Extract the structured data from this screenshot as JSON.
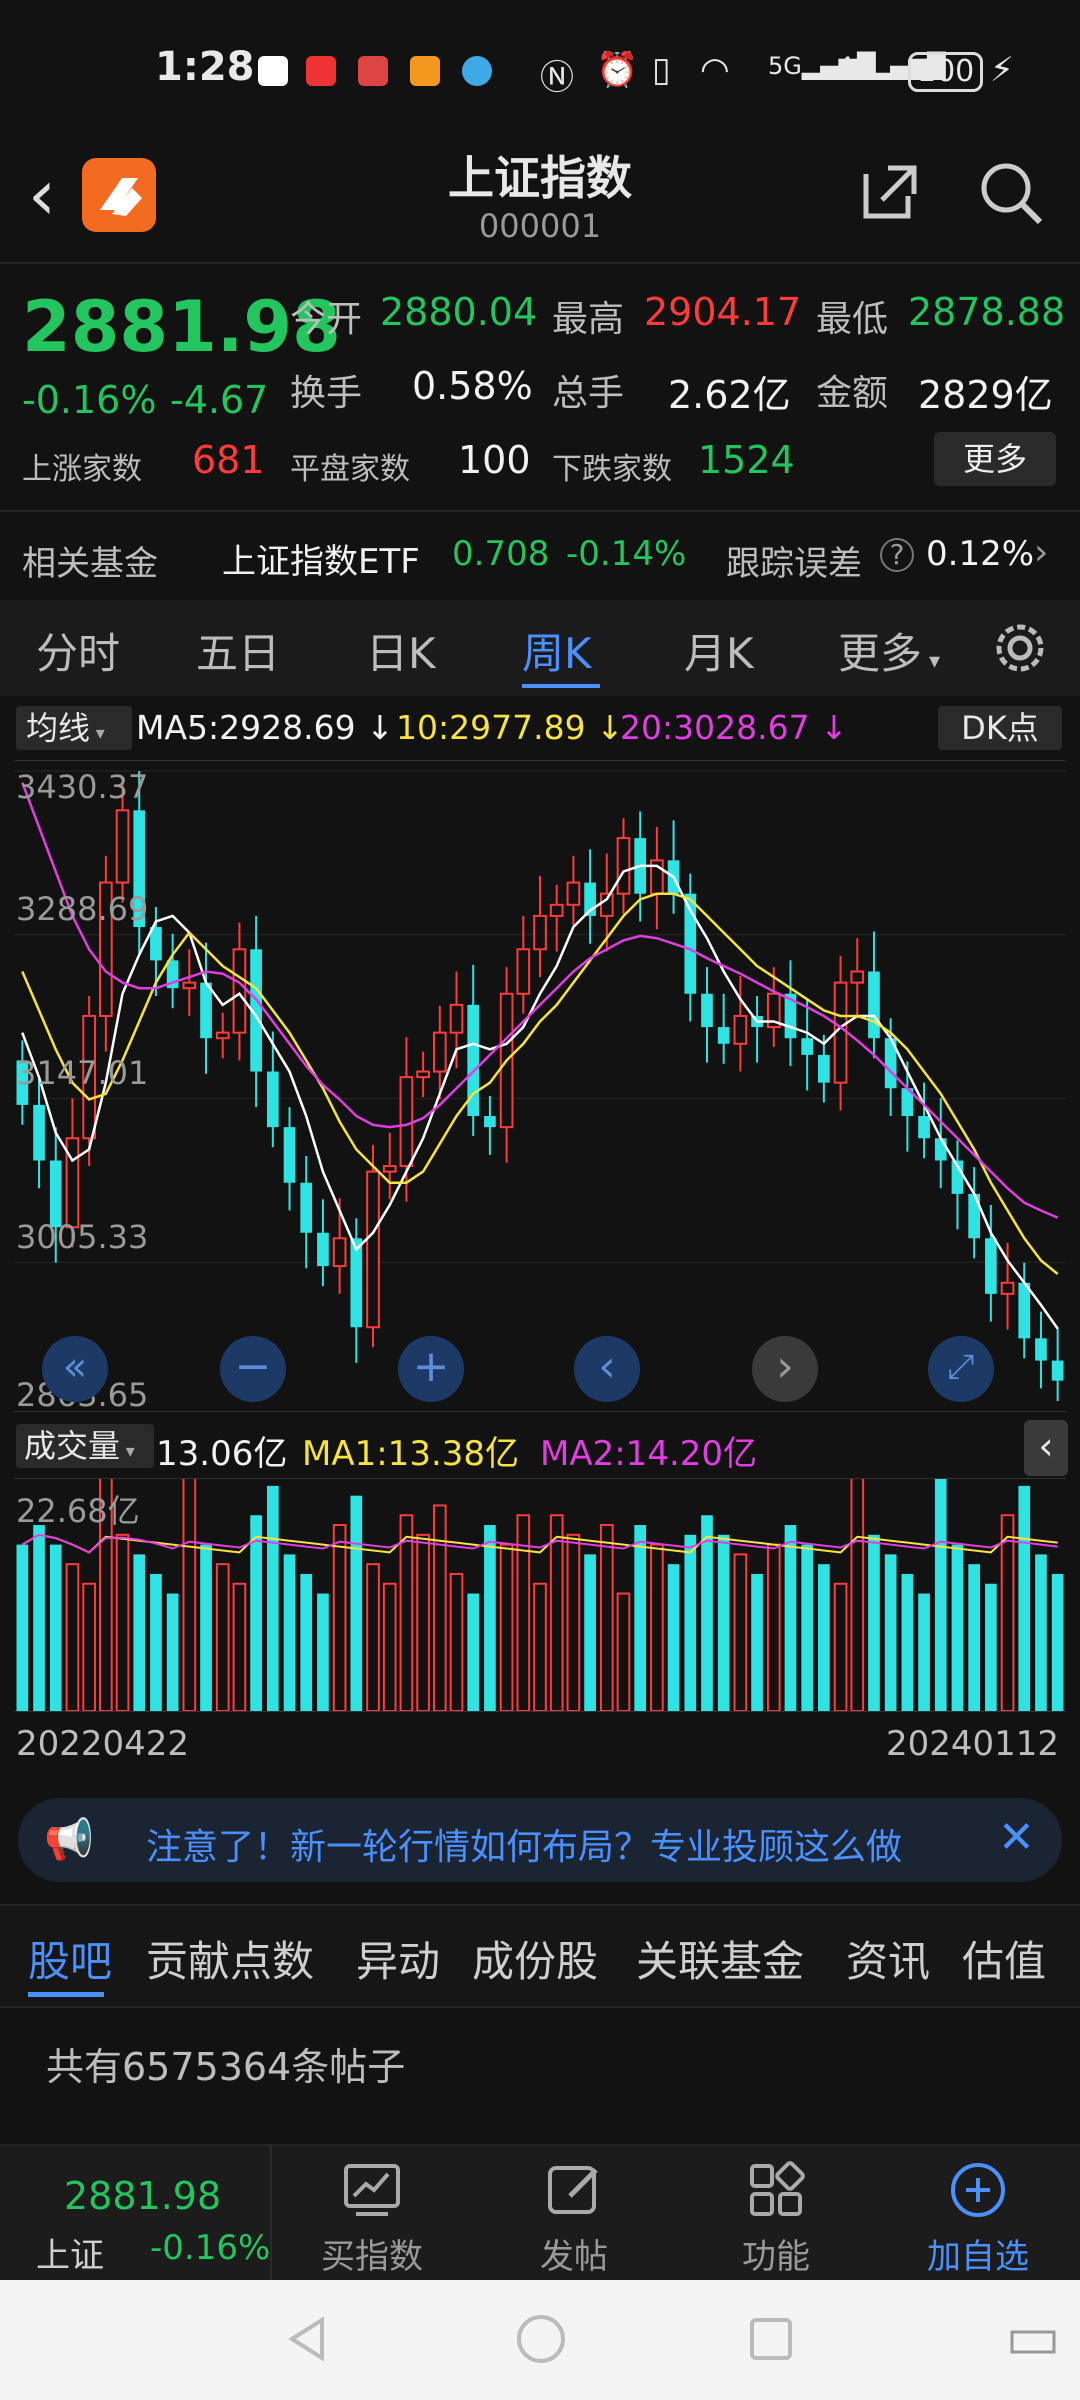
{
  "status_bar": {
    "time": "1:28",
    "battery": "100"
  },
  "header": {
    "title": "上证指数",
    "code": "000001"
  },
  "quote": {
    "price": "2881.98",
    "change_pct": "-0.16%",
    "change": "-4.67",
    "open_label": "今开",
    "open": "2880.04",
    "high_label": "最高",
    "high": "2904.17",
    "low_label": "最低",
    "low": "2878.88",
    "turnover_label": "换手",
    "turnover": "0.58%",
    "volume_label": "总手",
    "volume": "2.62亿",
    "amount_label": "金额",
    "amount": "2829亿",
    "up_label": "上涨家数",
    "up_count": "681",
    "flat_label": "平盘家数",
    "flat_count": "100",
    "down_label": "下跌家数",
    "down_count": "1524",
    "more": "更多"
  },
  "fund": {
    "label": "相关基金",
    "name": "上证指数ETF",
    "price": "0.708",
    "pct": "-0.14%",
    "err_label": "跟踪误差",
    "err": "0.12%"
  },
  "tabs": [
    "分时",
    "五日",
    "日K",
    "周K",
    "月K",
    "更多"
  ],
  "active_tab": 3,
  "kline": {
    "ma_selector": "均线",
    "ma5": "MA5:2928.69",
    "ma10": "10:2977.89",
    "ma20": "20:3028.67",
    "dk_button": "DK点",
    "y_labels": [
      "3430.37",
      "3288.69",
      "3147.01",
      "3005.33",
      "2863.65"
    ]
  },
  "volume_panel": {
    "selector": "成交量",
    "value": "13.06亿",
    "ma1": "MA1:13.38亿",
    "ma2": "MA2:14.20亿",
    "max_label": "22.68亿"
  },
  "x_labels": {
    "start": "20220422",
    "end": "20240112"
  },
  "banner": {
    "text": "注意了！新一轮行情如何布局？专业投顾这么做"
  },
  "content_tabs": [
    "股吧",
    "贡献点数",
    "异动",
    "成份股",
    "关联基金",
    "资讯",
    "估值"
  ],
  "posts": {
    "count_text": "共有6575364条帖子"
  },
  "bottom": {
    "mini_price": "2881.98",
    "mini_name": "上证",
    "mini_pct": "-0.16%",
    "items": [
      "买指数",
      "发帖",
      "功能",
      "加自选"
    ]
  },
  "colors": {
    "up": "#ff3b3b",
    "down": "#22c55e",
    "accent": "#4a90ff",
    "ma5": "#ffffff",
    "ma10": "#f5e342",
    "ma20": "#e03ee0",
    "bar_down": "#2fe3e3"
  },
  "chart_data": {
    "type": "candlestick",
    "ylim": [
      2863.65,
      3430.37
    ],
    "close": [
      3130,
      3080,
      3020,
      3100,
      3210,
      3330,
      3395,
      3290,
      3260,
      3235,
      3240,
      3190,
      3195,
      3270,
      3160,
      3110,
      3060,
      3015,
      2985,
      3010,
      2930,
      3070,
      3075,
      3155,
      3160,
      3195,
      3220,
      3120,
      3110,
      3230,
      3270,
      3300,
      3310,
      3330,
      3300,
      3320,
      3370,
      3320,
      3350,
      3320,
      3230,
      3200,
      3185,
      3210,
      3200,
      3230,
      3190,
      3175,
      3150,
      3240,
      3250,
      3190,
      3145,
      3120,
      3100,
      3080,
      3050,
      3010,
      2960,
      2970,
      2920,
      2900,
      2881.98
    ],
    "ma5": [
      3195,
      3155,
      3105,
      3080,
      3090,
      3150,
      3230,
      3265,
      3295,
      3300,
      3285,
      3240,
      3220,
      3230,
      3210,
      3185,
      3160,
      3120,
      3070,
      3035,
      3000,
      3015,
      3040,
      3070,
      3100,
      3140,
      3180,
      3185,
      3180,
      3185,
      3200,
      3230,
      3255,
      3290,
      3305,
      3315,
      3340,
      3345,
      3345,
      3335,
      3305,
      3280,
      3250,
      3225,
      3205,
      3205,
      3200,
      3195,
      3185,
      3200,
      3210,
      3210,
      3190,
      3160,
      3130,
      3100,
      3075,
      3050,
      3015,
      2990,
      2970,
      2950,
      2928.69
    ],
    "ma10": [
      3250,
      3215,
      3180,
      3150,
      3135,
      3140,
      3170,
      3205,
      3240,
      3265,
      3285,
      3270,
      3255,
      3245,
      3235,
      3215,
      3195,
      3170,
      3145,
      3115,
      3090,
      3075,
      3060,
      3060,
      3070,
      3095,
      3120,
      3140,
      3150,
      3170,
      3185,
      3205,
      3220,
      3240,
      3260,
      3280,
      3300,
      3315,
      3320,
      3320,
      3315,
      3300,
      3285,
      3270,
      3255,
      3245,
      3235,
      3225,
      3215,
      3210,
      3210,
      3205,
      3195,
      3180,
      3160,
      3140,
      3115,
      3090,
      3060,
      3035,
      3010,
      2990,
      2977.89
    ],
    "ma20": [
      3420,
      3380,
      3340,
      3300,
      3270,
      3250,
      3240,
      3235,
      3235,
      3240,
      3245,
      3250,
      3248,
      3240,
      3225,
      3205,
      3185,
      3165,
      3148,
      3135,
      3120,
      3112,
      3110,
      3112,
      3118,
      3130,
      3145,
      3160,
      3175,
      3190,
      3205,
      3220,
      3235,
      3250,
      3262,
      3270,
      3278,
      3282,
      3280,
      3275,
      3270,
      3262,
      3255,
      3248,
      3240,
      3232,
      3225,
      3218,
      3210,
      3200,
      3188,
      3175,
      3160,
      3145,
      3130,
      3115,
      3100,
      3085,
      3070,
      3055,
      3042,
      3035,
      3028.67
    ]
  }
}
